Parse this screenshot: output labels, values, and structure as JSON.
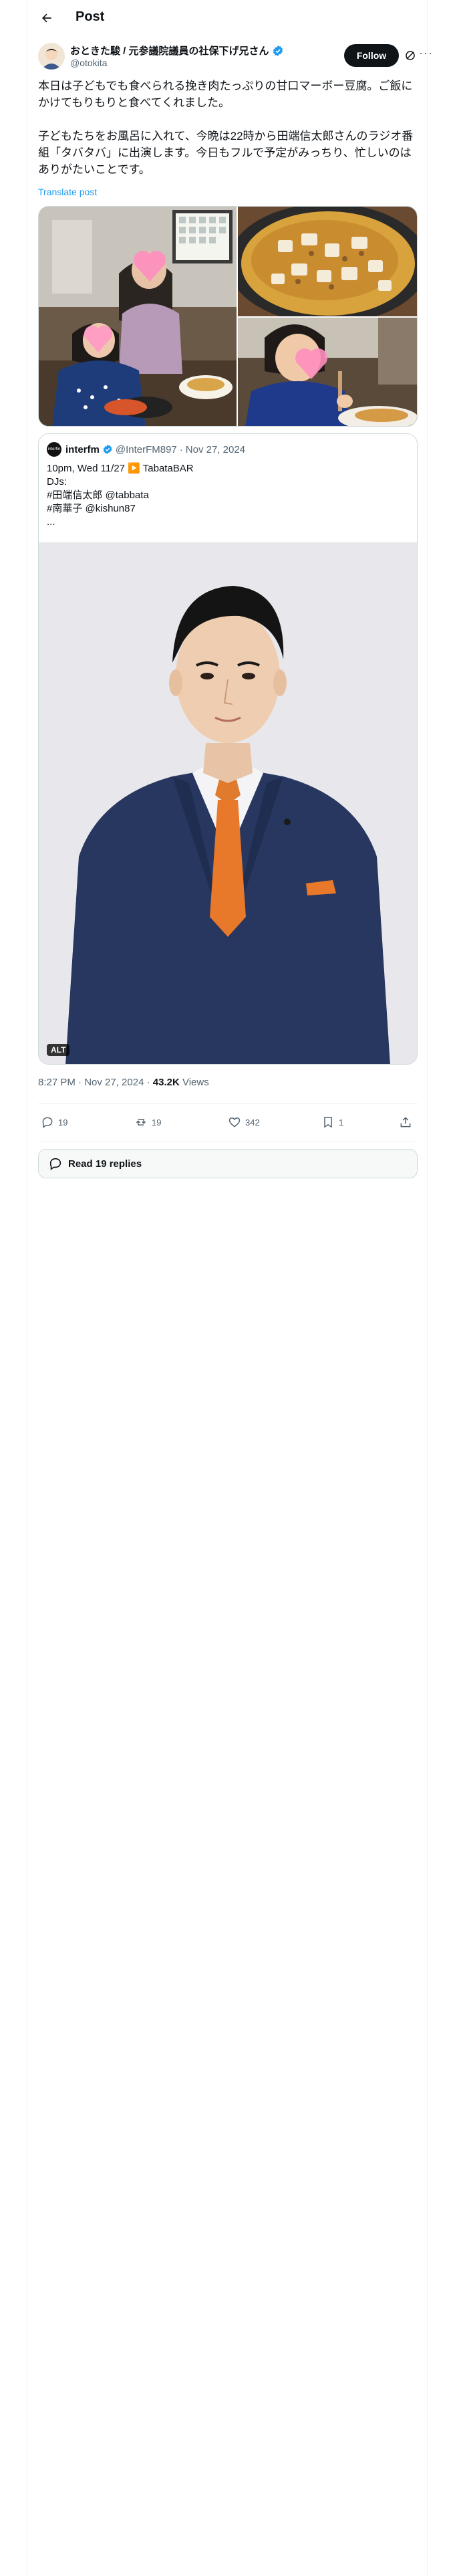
{
  "header": {
    "title": "Post",
    "back_icon": "arrow-left-icon"
  },
  "author": {
    "name": "おときた駿 / 元参議院議員の社保下げ兄さん",
    "handle": "@otokita",
    "verified": true,
    "follow_label": "Follow"
  },
  "tweet": {
    "text": "本日は子どもでも食べられる挽き肉たっぷりの甘口マーボー豆腐。ご飯にかけてもりもりと食べてくれました。\n\n子どもたちをお風呂に入れて、今晩は22時から田端信太郎さんのラジオ番組「タバタバ」に出演します。今日もフルで予定がみっちり、忙しいのはありがたいことです。",
    "translate_label": "Translate post"
  },
  "quote": {
    "account_name": "interfm",
    "avatar_text": "interfm",
    "handle": "@InterFM897",
    "date": "Nov 27, 2024",
    "line1": "10pm, Wed 11/27 ▶️ TabataBAR",
    "line2": "DJs:",
    "line3_tag": "#田端信太郎",
    "line3_mention": "@tabbata",
    "line4_tag": "#南華子",
    "line4_mention": "@kishun87",
    "line5": "...",
    "alt_label": "ALT"
  },
  "meta": {
    "time": "8:27 PM · Nov 27, 2024",
    "views_count": "43.2K",
    "views_label": "Views"
  },
  "actions": {
    "replies": "19",
    "reposts": "19",
    "likes": "342",
    "bookmarks": "1"
  },
  "read_replies_label": "Read 19 replies",
  "colors": {
    "accent": "#1d9bf0",
    "text": "#0f1419",
    "muted": "#536471",
    "tie": "#e8782a",
    "suit": "#27375f"
  }
}
